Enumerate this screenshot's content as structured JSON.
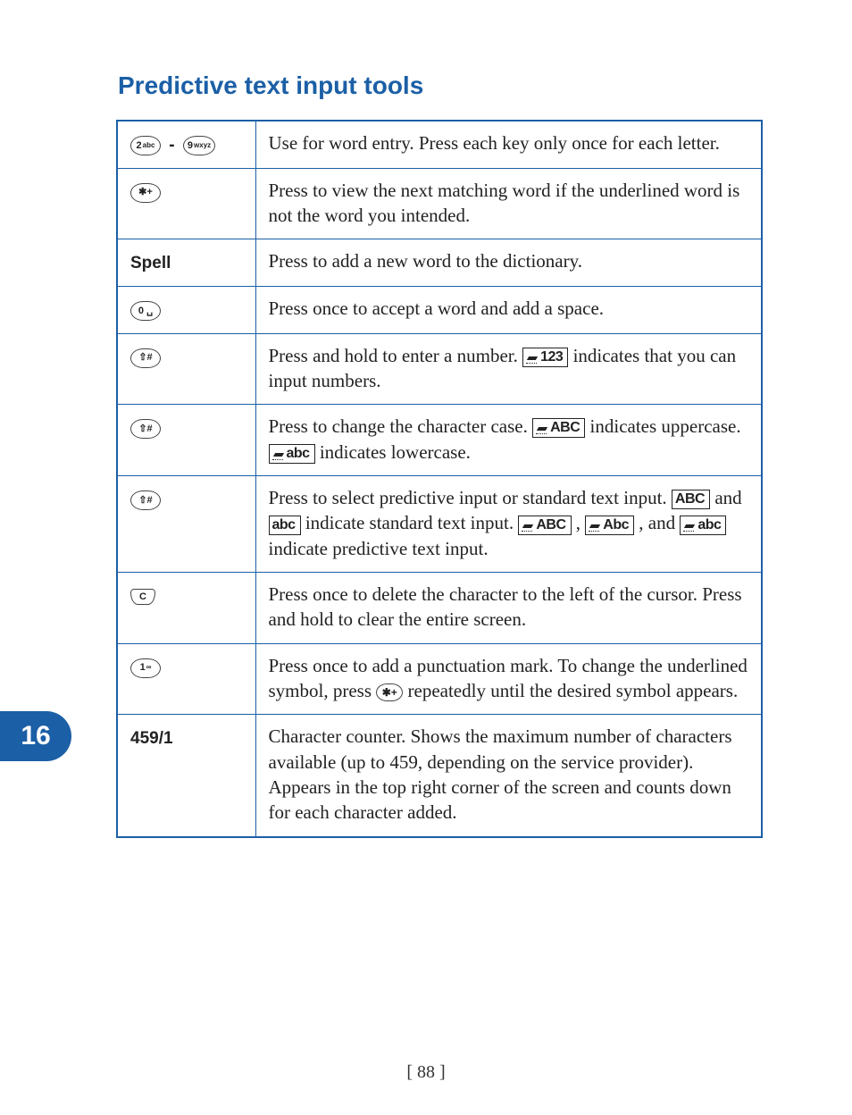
{
  "title": "Predictive text input tools",
  "section_tab": "16",
  "page_number": "[ 88 ]",
  "rows": {
    "r0": {
      "key_a": "2",
      "key_a_sub": "abc",
      "key_b": "9",
      "key_b_sub": "wxyz",
      "desc": "Use for word entry. Press each key only once for each letter."
    },
    "r1": {
      "key": "✱+",
      "desc": "Press to view the next matching word if the underlined word is not the word you intended."
    },
    "r2": {
      "key_label": "Spell",
      "desc": "Press to add a new word to the dictionary."
    },
    "r3": {
      "key": "0 ␣",
      "desc": "Press once to accept a word and add a space."
    },
    "r4": {
      "key": "⇧#",
      "desc_a": "Press and hold to enter a number. ",
      "ind": "123",
      "desc_b": " indicates that you can input numbers."
    },
    "r5": {
      "key": "⇧#",
      "desc_a": "Press to change the character case. ",
      "ind_a": "ABC",
      "desc_b": " indicates uppercase. ",
      "ind_b": "abc",
      "desc_c": " indicates lowercase."
    },
    "r6": {
      "key": "⇧#",
      "desc_a": "Press to select predictive input or standard text input. ",
      "ind_a": "ABC",
      "mid_a": " and ",
      "ind_b": "abc",
      "mid_b": " indicate standard text input. ",
      "ind_c": "ABC",
      "mid_c": ", ",
      "ind_d": "Abc",
      "mid_d": ", and ",
      "ind_e": "abc",
      "desc_b": " indicate predictive text input."
    },
    "r7": {
      "key": "C",
      "desc": "Press once to delete the character to the left of the cursor. Press and hold to clear the entire screen."
    },
    "r8": {
      "key": "1",
      "key_sub": "∞",
      "desc_a": "Press once to add a punctuation mark. To change the underlined symbol, press ",
      "inline_key": "✱+",
      "desc_b": " repeatedly until the desired symbol appears."
    },
    "r9": {
      "key_label": "459/1",
      "desc": "Character counter. Shows the maximum number of characters available (up to 459, depending on the service provider). Appears in the top right corner of the screen and counts down for each character added."
    }
  }
}
